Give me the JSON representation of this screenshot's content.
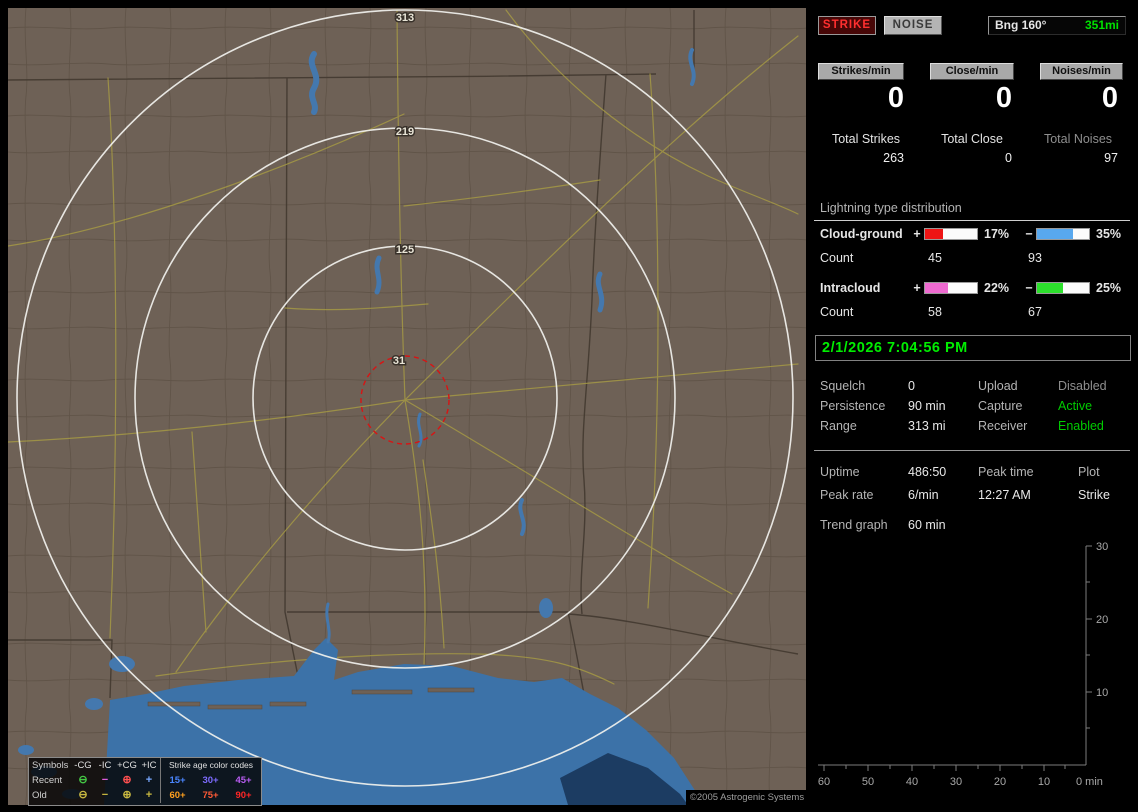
{
  "colors": {
    "map_land": "#6e6156",
    "map_water": "#3c72a8",
    "map_water_dark": "#1c3c62",
    "range_ring": "#f2f2ee",
    "alarm_ring": "#d81414",
    "road": "#a89c44",
    "strike_red": "#ff2f2f",
    "status_green": "#00cc00",
    "clock_green": "#00ee00",
    "bearing_green": "#00e000"
  },
  "toolbar": {
    "strike": "STRIKE",
    "noise": "NOISE",
    "bearing_label": "Bng 160°",
    "bearing_range": "351mi"
  },
  "rates": {
    "columns": [
      {
        "button": "Strikes/min",
        "rate": "0",
        "total_label": "Total Strikes",
        "total_value": "263"
      },
      {
        "button": "Close/min",
        "rate": "0",
        "total_label": "Total Close",
        "total_value": "0"
      },
      {
        "button": "Noises/min",
        "rate": "0",
        "total_label": "Total Noises",
        "total_value": "97"
      }
    ]
  },
  "distribution": {
    "title": "Lightning type distribution",
    "count_label": "Count",
    "plus_sign": "+",
    "minus_sign": "−",
    "rows": [
      {
        "name": "Cloud-ground",
        "pos_pct": "17%",
        "neg_pct": "35%",
        "pos_count": "45",
        "neg_count": "93",
        "pos_fill_style": "width:34%;background:#ee1515",
        "neg_fill_style": "width:70%;background:#58a8ee"
      },
      {
        "name": "Intracloud",
        "pos_pct": "22%",
        "neg_pct": "25%",
        "pos_count": "58",
        "neg_count": "67",
        "pos_fill_style": "width:44%;background:#ee6ad0",
        "neg_fill_style": "width:50%;background:#2ce02c"
      }
    ]
  },
  "clock": "2/1/2026 7:04:56 PM",
  "status": {
    "rows": [
      {
        "l1": "Squelch",
        "v1": "0",
        "l2": "Upload",
        "v2": "Disabled"
      },
      {
        "l1": "Persistence",
        "v1": "90 min",
        "l2": "Capture",
        "v2": "Active"
      },
      {
        "l1": "Range",
        "v1": "313 mi",
        "l2": "Receiver",
        "v2": "Enabled"
      }
    ]
  },
  "stats": {
    "uptime_label": "Uptime",
    "uptime": "486:50",
    "peak_time_label": "Peak time",
    "peak_time": "12:27 AM",
    "plot_label": "Plot",
    "plot": "Strike",
    "peak_rate_label": "Peak rate",
    "peak_rate": "6/min",
    "trend_label": "Trend graph",
    "trend_value": "60 min"
  },
  "trend_graph": {
    "y_ticks": [
      "30",
      "20",
      "10"
    ],
    "x_ticks": [
      "60",
      "50",
      "40",
      "30",
      "20",
      "10"
    ],
    "x_end_label": "0 min"
  },
  "map": {
    "rings": [
      "313",
      "219",
      "125",
      "31"
    ],
    "copyright": "©2005 Astrogenic Systems",
    "legend": {
      "symbols_title": "Symbols",
      "columns": [
        "-CG",
        "-IC",
        "+CG",
        "+IC"
      ],
      "age_title": "Strike age color codes",
      "rows": [
        {
          "label": "Recent",
          "symbols": [
            {
              "glyph": "⊖",
              "style": "color:#44c844"
            },
            {
              "glyph": "−",
              "style": "color:#e060e0"
            },
            {
              "glyph": "⊕",
              "style": "color:#ff5050"
            },
            {
              "glyph": "+",
              "style": "color:#78a8ff"
            }
          ],
          "ages": [
            {
              "text": "15+",
              "style": "color:#4a86ff"
            },
            {
              "text": "30+",
              "style": "color:#7d6bff"
            },
            {
              "text": "45+",
              "style": "color:#b85cf0"
            }
          ]
        },
        {
          "label": "Old",
          "symbols": [
            {
              "glyph": "⊖",
              "style": "color:#c8b840"
            },
            {
              "glyph": "−",
              "style": "color:#c8b840"
            },
            {
              "glyph": "⊕",
              "style": "color:#c8b840"
            },
            {
              "glyph": "+",
              "style": "color:#c8b840"
            }
          ],
          "ages": [
            {
              "text": "60+",
              "style": "color:#ffa01e"
            },
            {
              "text": "75+",
              "style": "color:#ff5a36"
            },
            {
              "text": "90+",
              "style": "color:#ff2626"
            }
          ]
        }
      ]
    }
  }
}
